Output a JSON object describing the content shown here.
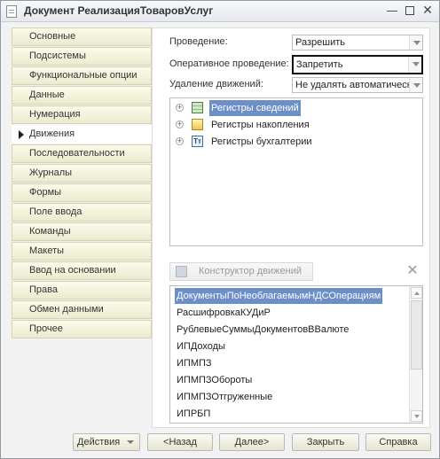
{
  "window": {
    "title": "Документ РеализацияТоваровУслуг",
    "controls": {
      "minimize": "—",
      "close": "✕"
    }
  },
  "nav": {
    "items": [
      {
        "label": "Основные",
        "active": false
      },
      {
        "label": "Подсистемы",
        "active": false
      },
      {
        "label": "Функциональные опции",
        "active": false
      },
      {
        "label": "Данные",
        "active": false
      },
      {
        "label": "Нумерация",
        "active": false
      },
      {
        "label": "Движения",
        "active": true
      },
      {
        "label": "Последовательности",
        "active": false
      },
      {
        "label": "Журналы",
        "active": false
      },
      {
        "label": "Формы",
        "active": false
      },
      {
        "label": "Поле ввода",
        "active": false
      },
      {
        "label": "Команды",
        "active": false
      },
      {
        "label": "Макеты",
        "active": false
      },
      {
        "label": "Ввод на основании",
        "active": false
      },
      {
        "label": "Права",
        "active": false
      },
      {
        "label": "Обмен данными",
        "active": false
      },
      {
        "label": "Прочее",
        "active": false
      }
    ]
  },
  "form": {
    "posting": {
      "label": "Проведение:",
      "value": "Разрешить"
    },
    "realtime_posting": {
      "label": "Оперативное проведение:",
      "value": "Запретить"
    },
    "delete_movements": {
      "label": "Удаление движений:",
      "value": "Не удалять автоматически"
    }
  },
  "tree": {
    "items": [
      {
        "label": "Регистры сведений",
        "icon": "info-register-icon",
        "selected": true
      },
      {
        "label": "Регистры накопления",
        "icon": "accumulation-register-icon",
        "selected": false
      },
      {
        "label": "Регистры бухгалтерии",
        "icon": "accounting-register-icon",
        "selected": false
      }
    ],
    "expander_symbol": "+",
    "accounting_icon_text": "Тт"
  },
  "constructor": {
    "label": "Конструктор движений",
    "close_symbol": "✕"
  },
  "documents": {
    "items": [
      {
        "label": "ДокументыПоНеоблагаемымНДСОперациям",
        "selected": true
      },
      {
        "label": "РасшифровкаКУДиР",
        "selected": false
      },
      {
        "label": "РублевыеСуммыДокументовВВалюте",
        "selected": false
      },
      {
        "label": "ИПДоходы",
        "selected": false
      },
      {
        "label": "ИПМПЗ",
        "selected": false
      },
      {
        "label": "ИПМПЗОбороты",
        "selected": false
      },
      {
        "label": "ИПМПЗОтгруженные",
        "selected": false
      },
      {
        "label": "ИПРБП",
        "selected": false
      }
    ]
  },
  "buttons": {
    "actions": "Действия",
    "back": "<Назад",
    "next": "Далее>",
    "close": "Закрыть",
    "help": "Справка"
  },
  "colors": {
    "selection": "#6c8fc8",
    "nav_tab": "#f4f2dc"
  }
}
